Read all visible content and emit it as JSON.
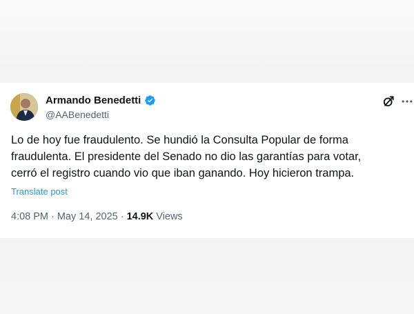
{
  "author": {
    "name": "Armando Benedetti",
    "handle": "@AABenedetti",
    "verified": true
  },
  "tweet": {
    "text": "Lo de hoy fue fraudulento. Se hundió la Consulta Popular de forma\nfraudulenta. El presidente del Senado no dio las garantías para votar,\ncerró el registro cuando vio que iban ganando. Hoy hicieron trampa.",
    "translate_label": "Translate post",
    "time": "4:08 PM",
    "separator1": "·",
    "date": "May 14, 2025",
    "separator2": "·",
    "views_count": "14.9K",
    "views_label": "Views"
  },
  "icons": {
    "verified": "verified-badge-icon",
    "grok": "grok-icon",
    "more": "more-options-icon"
  },
  "colors": {
    "verified_blue": "#1d9bf0",
    "text_primary": "#0f1419",
    "text_secondary": "#536471",
    "link": "#1d9bf0"
  }
}
